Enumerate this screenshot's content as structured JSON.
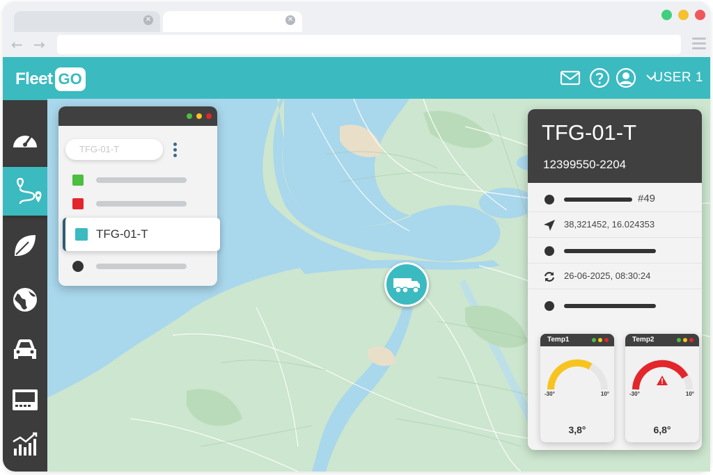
{
  "app": {
    "logo_text": "Fleet",
    "logo_box": "GO"
  },
  "header": {
    "user_label": "USER 1"
  },
  "colors": {
    "accent": "#3bbac0",
    "dark": "#404040",
    "green": "#4cbf3e",
    "red": "#e3262b",
    "yellow": "#f7c41f"
  },
  "sidebar": {
    "items": [
      {
        "name": "dashboard",
        "icon": "speedometer-icon"
      },
      {
        "name": "routes",
        "icon": "route-icon",
        "active": true
      },
      {
        "name": "eco",
        "icon": "leaf-icon"
      },
      {
        "name": "globe",
        "icon": "globe-icon"
      },
      {
        "name": "vehicles",
        "icon": "car-icon"
      },
      {
        "name": "device",
        "icon": "device-icon"
      },
      {
        "name": "reports",
        "icon": "chart-icon"
      }
    ]
  },
  "vehicle_list": {
    "search_value": "TFG-01-T",
    "selected_label": "TFG-01-T"
  },
  "detail": {
    "title": "TFG-01-T",
    "subtitle": "12399550-2204",
    "number": "#49",
    "coordinates": "38,321452, 16.024353",
    "timestamp": "26-06-2025, 08:30:24"
  },
  "gauges": [
    {
      "name": "Temp1",
      "min": "-30°",
      "max": "10°",
      "value": "3,8°",
      "color": "#f7c41f"
    },
    {
      "name": "Temp2",
      "min": "-30°",
      "max": "10°",
      "value": "6,8°",
      "color": "#e3262b"
    }
  ]
}
